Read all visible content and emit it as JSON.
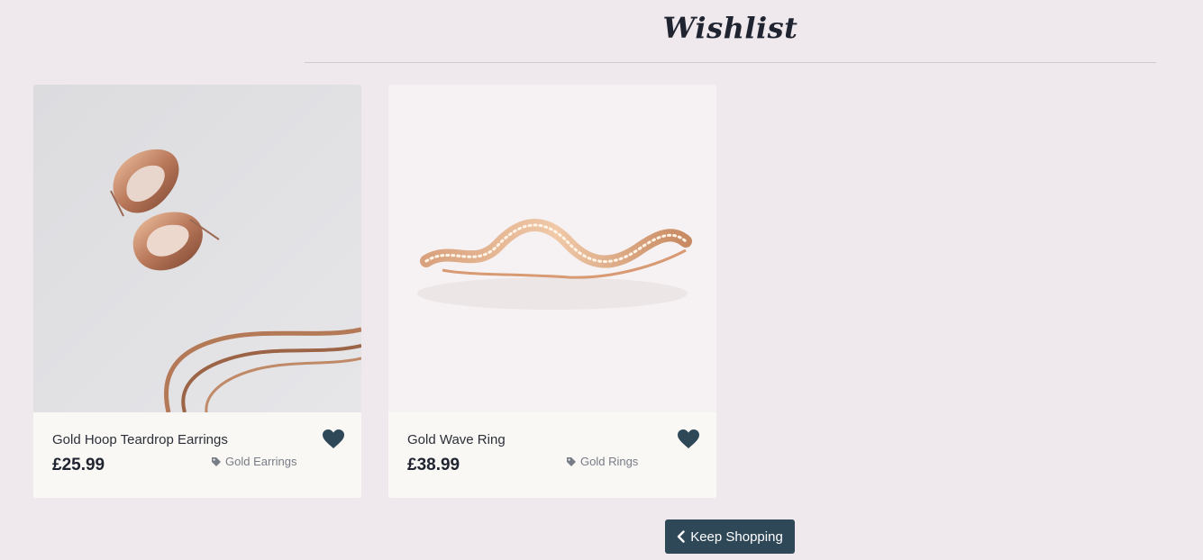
{
  "page": {
    "title": "Wishlist"
  },
  "colors": {
    "background": "#efe8ec",
    "card": "#faf8f5",
    "accent": "#2f4858",
    "text": "#1f2430",
    "muted": "#777c86"
  },
  "items": [
    {
      "name": "Gold Hoop Teardrop Earrings",
      "price": "£25.99",
      "category": "Gold Earrings",
      "category_icon": "tag-icon",
      "wishlist_icon": "heart-icon",
      "image": "gold-hoop-teardrop-earrings-photo"
    },
    {
      "name": "Gold Wave Ring",
      "price": "£38.99",
      "category": "Gold Rings",
      "category_icon": "tag-icon",
      "wishlist_icon": "heart-icon",
      "image": "gold-wave-ring-photo"
    }
  ],
  "actions": {
    "keep_shopping_label": "Keep Shopping",
    "keep_shopping_icon": "chevron-left-icon"
  }
}
